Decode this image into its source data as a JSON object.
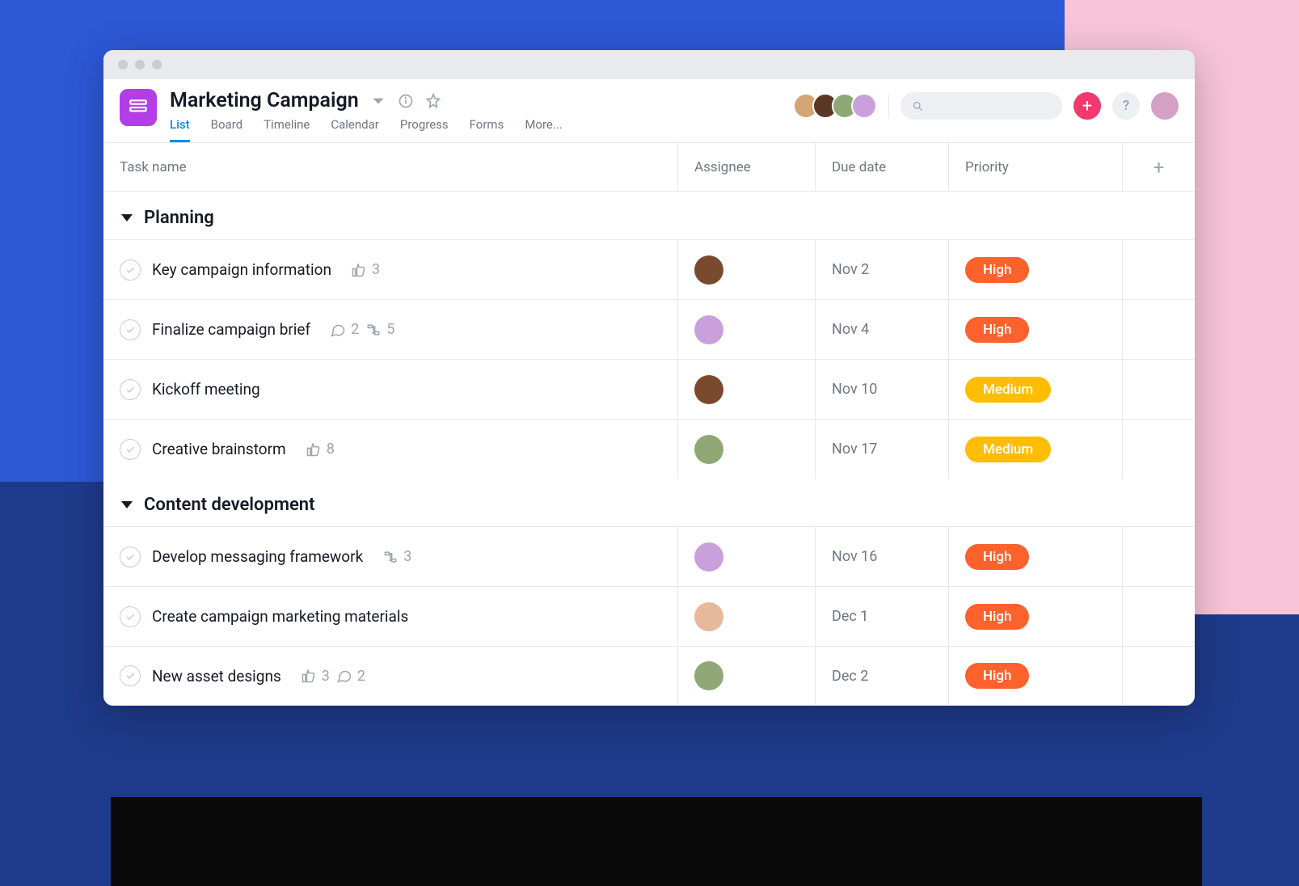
{
  "project": {
    "title": "Marketing Campaign",
    "icon": "list-icon",
    "accent": "#b43ee6"
  },
  "tabs": [
    {
      "label": "List",
      "active": true
    },
    {
      "label": "Board",
      "active": false
    },
    {
      "label": "Timeline",
      "active": false
    },
    {
      "label": "Calendar",
      "active": false
    },
    {
      "label": "Progress",
      "active": false
    },
    {
      "label": "Forms",
      "active": false
    },
    {
      "label": "More...",
      "active": false
    }
  ],
  "members": [
    "avatar-1",
    "avatar-2",
    "avatar-3",
    "avatar-4"
  ],
  "columns": {
    "task": "Task name",
    "assignee": "Assignee",
    "due": "Due date",
    "priority": "Priority"
  },
  "sections": [
    {
      "name": "Planning",
      "tasks": [
        {
          "name": "Key campaign information",
          "likes": 3,
          "comments": null,
          "subtasks": null,
          "assignee": "av-4",
          "due": "Nov 2",
          "priority": "High"
        },
        {
          "name": "Finalize campaign brief",
          "likes": null,
          "comments": 2,
          "subtasks": 5,
          "assignee": "av-3",
          "due": "Nov 4",
          "priority": "High"
        },
        {
          "name": "Kickoff meeting",
          "likes": null,
          "comments": null,
          "subtasks": null,
          "assignee": "av-4",
          "due": "Nov 10",
          "priority": "Medium"
        },
        {
          "name": "Creative brainstorm",
          "likes": 8,
          "comments": null,
          "subtasks": null,
          "assignee": "av-2",
          "due": "Nov 17",
          "priority": "Medium"
        }
      ]
    },
    {
      "name": "Content development",
      "tasks": [
        {
          "name": "Develop messaging framework",
          "likes": null,
          "comments": null,
          "subtasks": 3,
          "assignee": "av-3",
          "due": "Nov 16",
          "priority": "High"
        },
        {
          "name": "Create campaign marketing materials",
          "likes": null,
          "comments": null,
          "subtasks": null,
          "assignee": "av-5",
          "due": "Dec 1",
          "priority": "High"
        },
        {
          "name": "New asset designs",
          "likes": 3,
          "comments": 2,
          "subtasks": null,
          "assignee": "av-2",
          "due": "Dec 2",
          "priority": "High"
        }
      ]
    }
  ],
  "buttons": {
    "add": "+",
    "help": "?",
    "add_column": "+"
  }
}
